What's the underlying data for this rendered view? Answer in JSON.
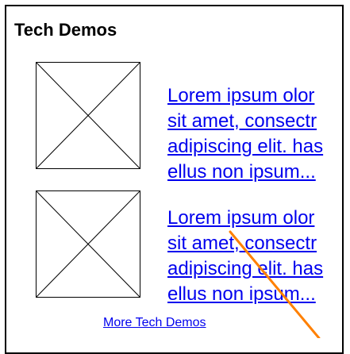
{
  "widget": {
    "title": "Tech Demos",
    "items": [
      {
        "lines": [
          "Lorem ipsum olor",
          "sit amet, consectr",
          "adipiscing elit. has",
          "ellus non ipsum..."
        ]
      },
      {
        "lines": [
          "Lorem ipsum olor",
          "sit amet, consectr",
          "adipiscing elit. has",
          "ellus non ipsum..."
        ]
      }
    ],
    "more_link": "More Tech Demos"
  },
  "colors": {
    "link": "#0000ee",
    "text": "#000000",
    "border": "#000000",
    "annotation_line": "#ff8000"
  }
}
